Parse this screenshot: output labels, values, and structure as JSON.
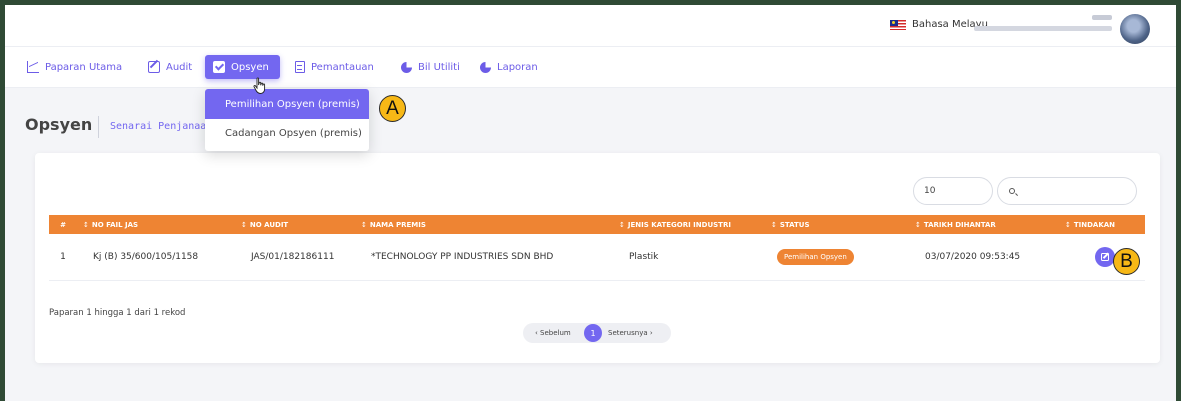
{
  "topbar": {
    "language_label": "Bahasa Melayu"
  },
  "nav": {
    "items": [
      {
        "label": "Paparan Utama",
        "icon": "chart-line-icon"
      },
      {
        "label": "Audit",
        "icon": "edit-icon"
      },
      {
        "label": "Opsyen",
        "icon": "check-square-icon",
        "active": true
      },
      {
        "label": "Pemantauan",
        "icon": "document-icon"
      },
      {
        "label": "Bil Utiliti",
        "icon": "pie-chart-icon"
      },
      {
        "label": "Laporan",
        "icon": "pie-chart-icon"
      }
    ]
  },
  "dropdown": {
    "items": [
      {
        "label": "Pemilihan Opsyen (premis)",
        "active": true
      },
      {
        "label": "Cadangan Opsyen (premis)"
      }
    ]
  },
  "callouts": {
    "a": "A",
    "b": "B"
  },
  "page": {
    "title": "Opsyen",
    "subtitle": "Senarai Penjanaan"
  },
  "controls": {
    "per_page": "10",
    "search_placeholder": ""
  },
  "table": {
    "columns": [
      "#",
      "NO FAIL JAS",
      "NO AUDIT",
      "NAMA PREMIS",
      "JENIS KATEGORI INDUSTRI",
      "STATUS",
      "TARIKH DIHANTAR",
      "TINDAKAN"
    ],
    "rows": [
      {
        "no": "1",
        "no_fail_jas": "Kj (B) 35/600/105/1158",
        "no_audit": "JAS/01/182186111",
        "nama_premis": "*TECHNOLOGY PP INDUSTRIES SDN BHD",
        "kategori": "Plastik",
        "status": "Pemilihan Opsyen",
        "tarikh": "03/07/2020 09:53:45"
      }
    ]
  },
  "footer": {
    "info": "Paparan 1 hingga 1 dari 1 rekod",
    "prev": "‹ Sebelum",
    "page": "1",
    "next": "Seterusnya ›"
  },
  "colors": {
    "accent": "#7367f0",
    "header_orange": "#ee8433",
    "callout_yellow": "#f7b816",
    "frame": "#2f4a35"
  }
}
